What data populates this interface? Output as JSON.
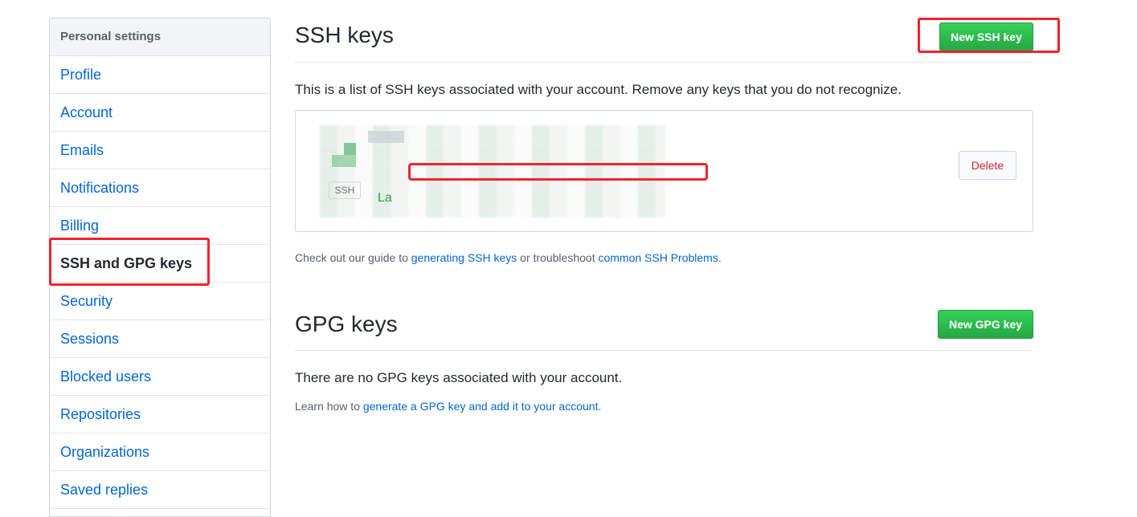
{
  "sidebar": {
    "header": "Personal settings",
    "items": [
      {
        "label": "Profile"
      },
      {
        "label": "Account"
      },
      {
        "label": "Emails"
      },
      {
        "label": "Notifications"
      },
      {
        "label": "Billing"
      },
      {
        "label": "SSH and GPG keys",
        "selected": true
      },
      {
        "label": "Security"
      },
      {
        "label": "Sessions"
      },
      {
        "label": "Blocked users"
      },
      {
        "label": "Repositories"
      },
      {
        "label": "Organizations"
      },
      {
        "label": "Saved replies"
      }
    ]
  },
  "ssh": {
    "title": "SSH keys",
    "new_button": "New SSH key",
    "intro": "This is a list of SSH keys associated with your account. Remove any keys that you do not recognize.",
    "key": {
      "badge": "SSH",
      "added_text": "La",
      "delete_button": "Delete"
    },
    "guide": {
      "prefix": "Check out our guide to ",
      "link1": "generating SSH keys",
      "middle": " or troubleshoot ",
      "link2": "common SSH Problems",
      "suffix": "."
    }
  },
  "gpg": {
    "title": "GPG keys",
    "new_button": "New GPG key",
    "empty": "There are no GPG keys associated with your account.",
    "learn": {
      "prefix": "Learn how to ",
      "link": "generate a GPG key and add it to your account",
      "suffix": "."
    }
  },
  "colors": {
    "accent_link": "#0366d6",
    "button_green": "#28a745",
    "danger": "#cb2431",
    "annotation_red": "#f5222d"
  }
}
